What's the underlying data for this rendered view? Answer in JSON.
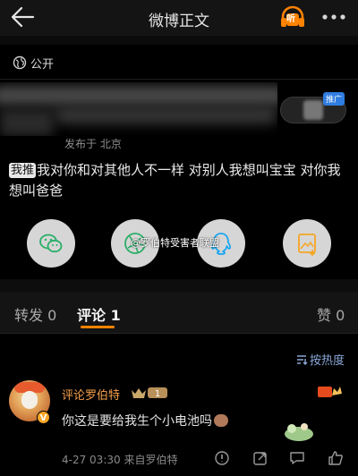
{
  "header": {
    "title": "微博正文",
    "listen_label": "听"
  },
  "post": {
    "visibility": "公开",
    "posted_from": "发布于 北京",
    "promo_tag": "推广",
    "topic_tag": "我推",
    "text": "我对你和对其他人不一样 对别人我想叫宝宝 对你我想叫爸爸"
  },
  "share": {
    "items": [
      {
        "icon": "wechat-icon",
        "color": "#2aae67"
      },
      {
        "icon": "moments-icon",
        "color": "#2aae67"
      },
      {
        "icon": "qq-icon",
        "color": "#1aa6f0"
      },
      {
        "icon": "save-image-icon",
        "color": "#f5a623"
      }
    ],
    "watermark": "@罗伯特受害者联盟"
  },
  "tabs": {
    "repost_label": "转发",
    "repost_count": "0",
    "comments_label": "评论",
    "comments_count": "1",
    "likes_label": "赞",
    "likes_count": "0",
    "sort_label": "按热度"
  },
  "comment": {
    "username": "评论罗伯特",
    "vip_level": "1",
    "text": "你这是要给我生个小电池吗",
    "timestamp": "4-27 03:30",
    "source": "来自罗伯特"
  },
  "colors": {
    "accent": "#ff8200",
    "username": "#f7a04b",
    "link": "#8aa7d6"
  }
}
